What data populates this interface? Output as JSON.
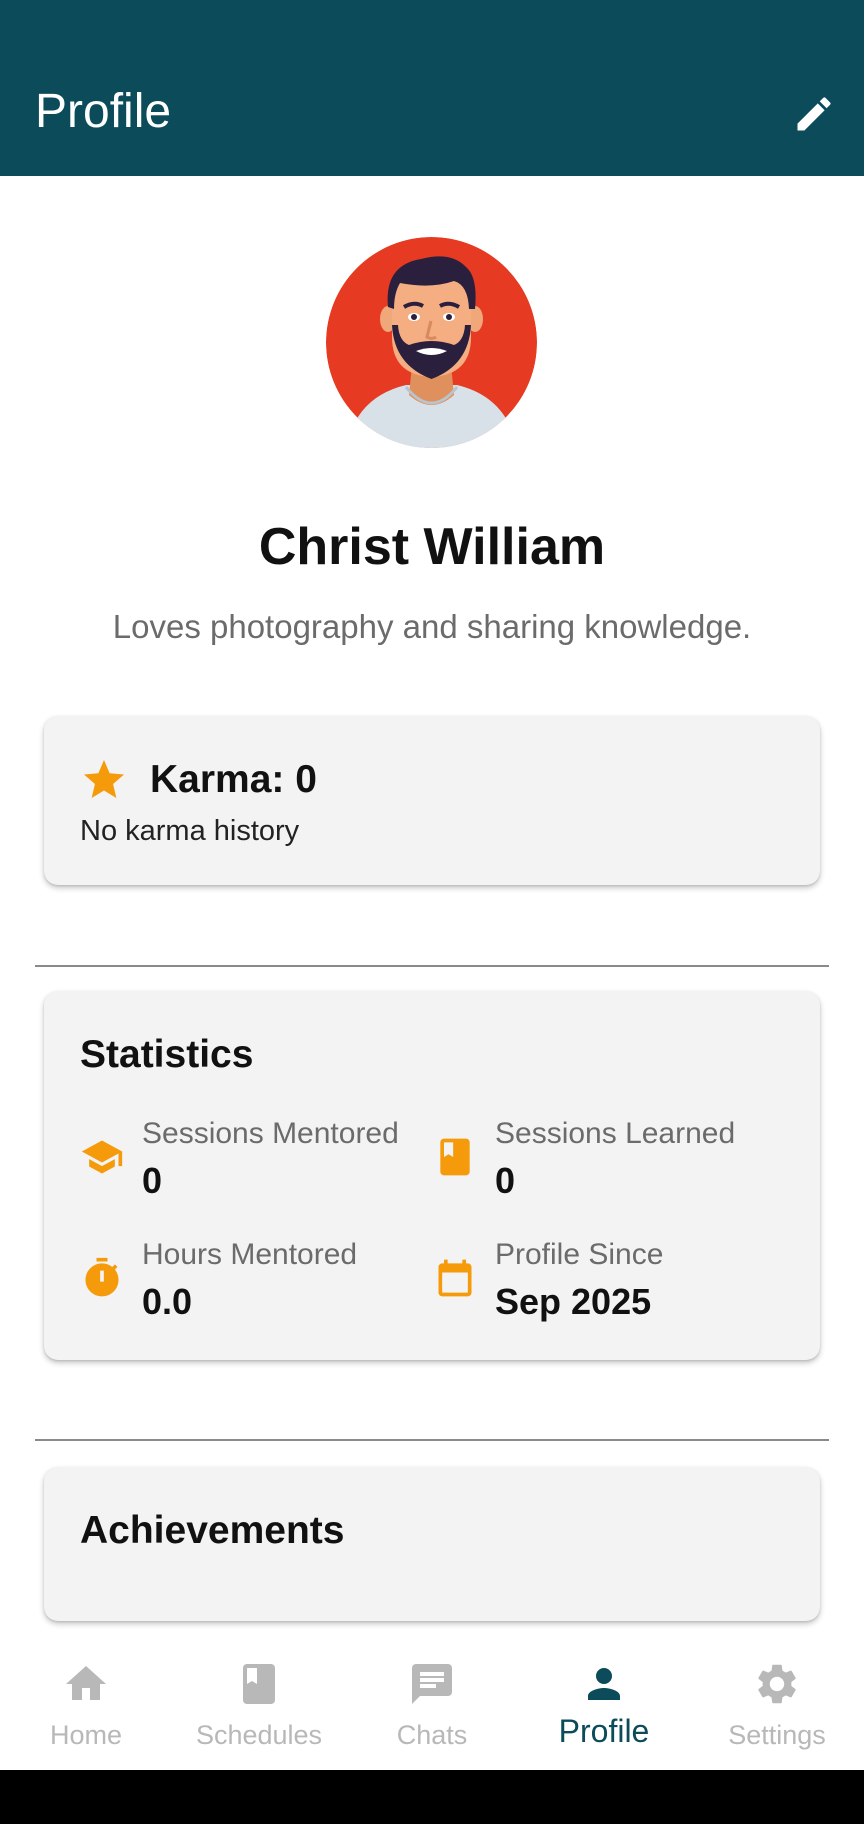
{
  "appbar": {
    "title": "Profile",
    "edit_icon": "pencil-icon"
  },
  "profile": {
    "name": "Christ William",
    "bio": "Loves photography and sharing knowledge.",
    "avatar_icon": "avatar-illustration"
  },
  "karma": {
    "title": "Karma: 0",
    "subtitle": "No karma history",
    "icon": "star-icon"
  },
  "statistics": {
    "title": "Statistics",
    "items": [
      {
        "label": "Sessions Mentored",
        "value": "0",
        "icon": "graduation-cap-icon"
      },
      {
        "label": "Sessions Learned",
        "value": "0",
        "icon": "book-icon"
      },
      {
        "label": "Hours Mentored",
        "value": "0.0",
        "icon": "timer-icon"
      },
      {
        "label": "Profile Since",
        "value": "Sep 2025",
        "icon": "calendar-icon"
      }
    ]
  },
  "achievements": {
    "title": "Achievements"
  },
  "bottom_nav": {
    "items": [
      {
        "label": "Home",
        "icon": "home-icon",
        "active": false
      },
      {
        "label": "Schedules",
        "icon": "book-icon",
        "active": false
      },
      {
        "label": "Chats",
        "icon": "chat-icon",
        "active": false
      },
      {
        "label": "Profile",
        "icon": "person-icon",
        "active": true
      },
      {
        "label": "Settings",
        "icon": "gear-icon",
        "active": false
      }
    ]
  },
  "colors": {
    "primary": "#0b4b5a",
    "accent": "#f59a0a",
    "avatar_bg": "#e63b22",
    "card_bg": "#f3f3f3",
    "inactive": "#b8b8b8"
  }
}
